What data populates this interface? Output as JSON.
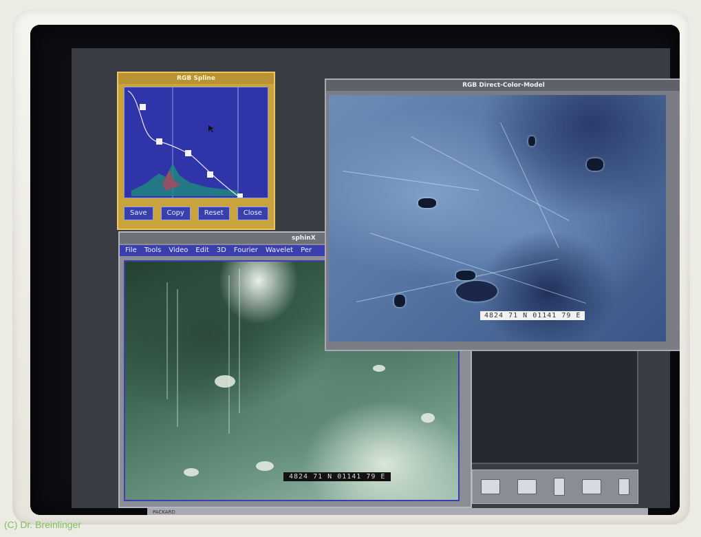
{
  "windows": {
    "spline": {
      "title": "RGB Spline",
      "buttons": [
        "Save",
        "Copy",
        "Reset",
        "Close"
      ]
    },
    "rgb_model": {
      "title": "RGB Direct-Color-Model",
      "coordinate_overlay": "4824 71 N 01141 79 E"
    },
    "sphinx": {
      "title": "sphinX",
      "menu": [
        "File",
        "Tools",
        "Video",
        "Edit",
        "3D",
        "Fourier",
        "Wavelet",
        "Per"
      ],
      "coordinate_overlay": "4824 71 N 01141 79 E"
    }
  },
  "desktop": {
    "bottom_label": "PACKARD",
    "taskbar_icons": [
      "car-icon",
      "card-icon",
      "device-icon",
      "tool-icon",
      "trash-icon"
    ]
  },
  "caption": "(C) Dr. Breinlinger",
  "colors": {
    "spline_frame": "#c9a43c",
    "plot_background": "#2f35a8",
    "menubar": "#3b3fae"
  }
}
